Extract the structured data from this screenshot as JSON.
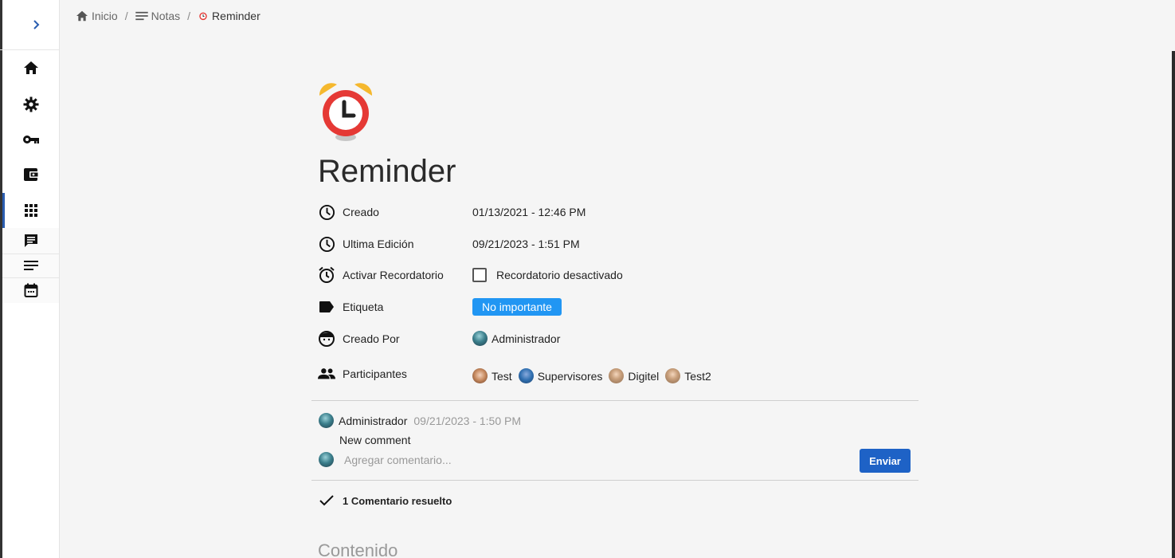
{
  "breadcrumb": {
    "home_label": "Inicio",
    "notes_label": "Notas",
    "current_label": "Reminder",
    "separator": "/"
  },
  "sidebar": {
    "toggle_icon": "chevron-right-icon",
    "items": [
      {
        "icon": "home-icon"
      },
      {
        "icon": "gear-icon"
      },
      {
        "icon": "key-icon"
      },
      {
        "icon": "wallet-icon"
      },
      {
        "icon": "apps-grid-icon",
        "active": true
      },
      {
        "icon": "chat-icon"
      },
      {
        "icon": "notes-list-icon"
      },
      {
        "icon": "calendar-icon"
      }
    ]
  },
  "page": {
    "title": "Reminder",
    "icon": "alarm-clock-icon"
  },
  "properties": {
    "created_label": "Creado",
    "created_value": "01/13/2021 - 12:46 PM",
    "edited_label": "Ultima Edición",
    "edited_value": "09/21/2023 - 1:51 PM",
    "reminder_label": "Activar Recordatorio",
    "reminder_value": "Recordatorio desactivado",
    "tag_label": "Etiqueta",
    "tag_value": "No importante",
    "created_by_label": "Creado Por",
    "created_by_value": "Administrador",
    "participants_label": "Participantes",
    "participants": [
      "Test",
      "Supervisores",
      "Digitel",
      "Test2"
    ]
  },
  "comment": {
    "author": "Administrador",
    "time": "09/21/2023 - 1:50 PM",
    "text": "New comment",
    "input_placeholder": "Agregar comentario...",
    "send_label": "Enviar"
  },
  "resolved_label": "1 Comentario resuelto",
  "content_heading": "Contenido",
  "colors": {
    "accent": "#1e62c6",
    "tag": "#2196f3",
    "active_nav": "#2a5db0"
  }
}
